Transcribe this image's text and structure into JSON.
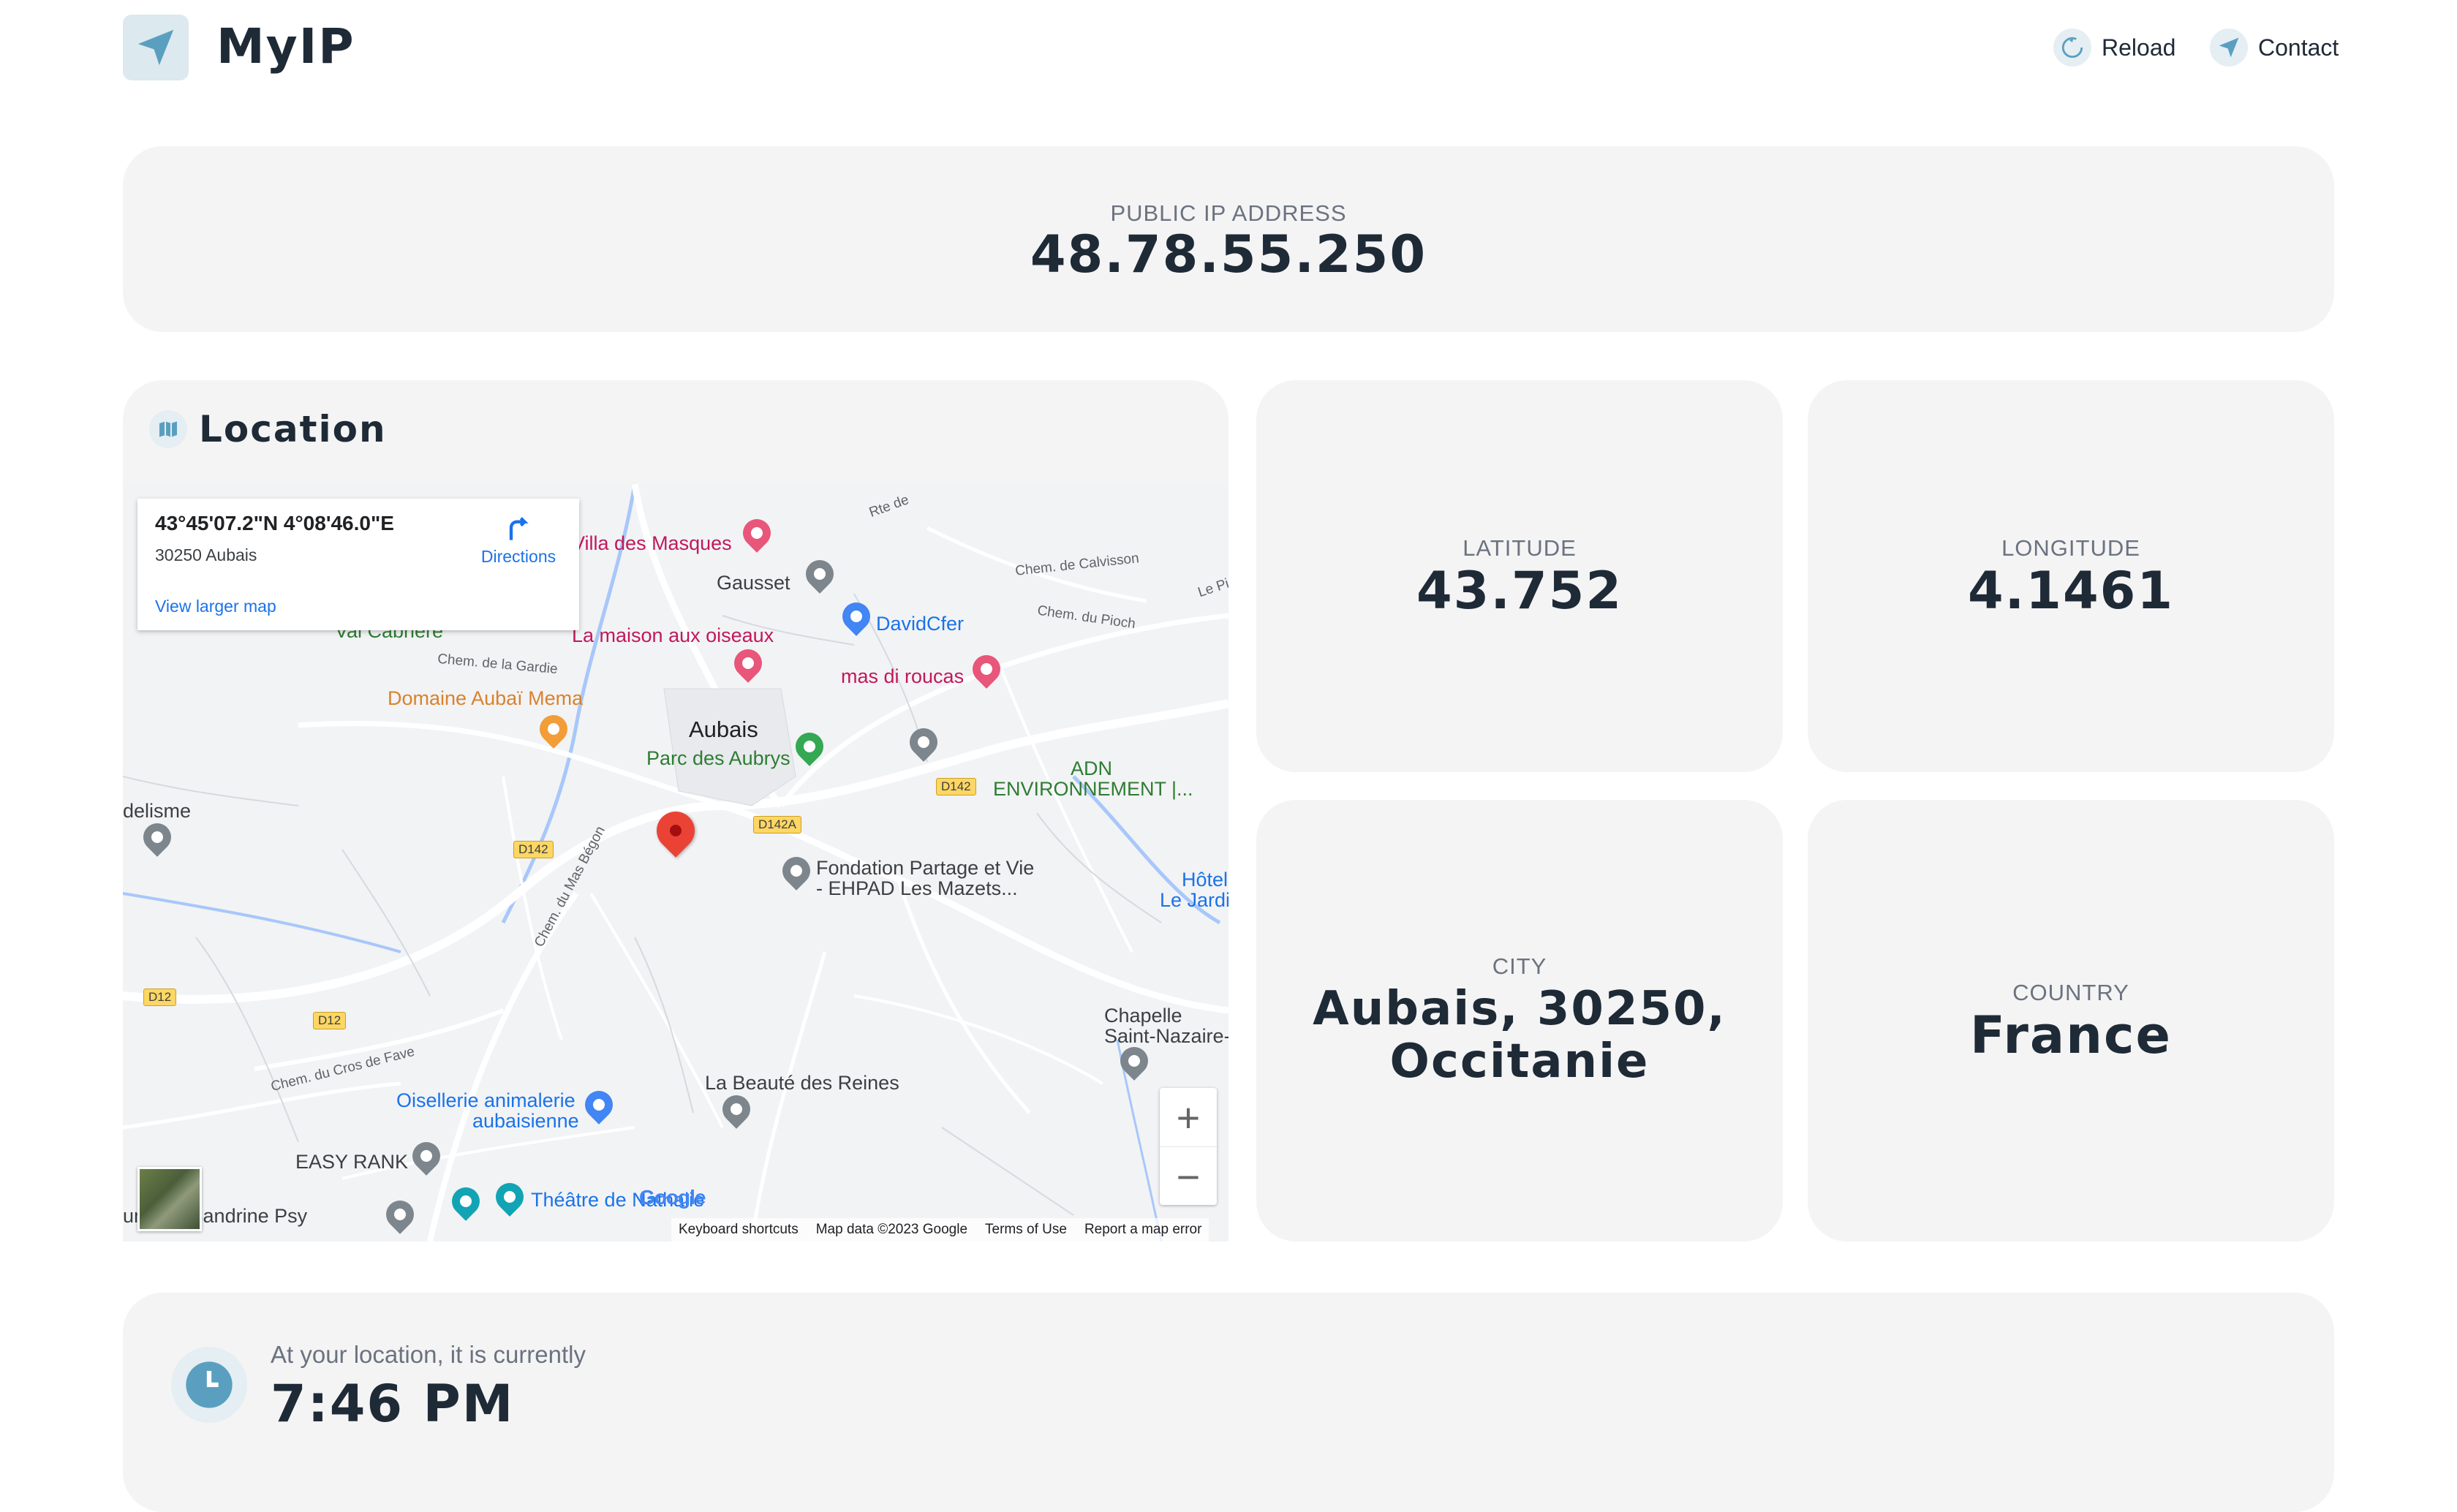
{
  "header": {
    "app_name": "MyIP",
    "nav": [
      {
        "label": "Reload",
        "icon": "reload-icon"
      },
      {
        "label": "Contact",
        "icon": "send-icon"
      }
    ]
  },
  "ip": {
    "label": "PUBLIC IP ADDRESS",
    "value": "48.78.55.250"
  },
  "location": {
    "title": "Location",
    "map": {
      "info": {
        "coords": "43°45'07.2\"N 4°08'46.0\"E",
        "address": "30250 Aubais",
        "directions": "Directions",
        "view_larger": "View larger map"
      },
      "places": [
        "Villa des Masques",
        "Gausset",
        "DavidCfer",
        "La maison aux oiseaux",
        "mas di roucas",
        "Val Cabrière",
        "Domaine Aubaï Mema",
        "Aubais",
        "Parc des Aubrys",
        "ADN",
        "ENVIRONNEMENT |...",
        "delisme",
        "Fondation Partage et Vie",
        "- EHPAD Les Mazets...",
        "Hôtel",
        "Le Jardi",
        "Chapelle",
        "Saint-Nazaire-",
        "La Beauté des Reines",
        "Oisellerie animalerie",
        "aubaisienne",
        "EASY RANK",
        "Théâtre de Nathalie",
        "umbert Sandrine Psy"
      ],
      "roads": [
        "Rte de",
        "Chem. de Calvisson",
        "Chem. du Pioch",
        "Chem. de la Gardie",
        "Chem. du Mas Bégon",
        "Chem. du Cros de Fave",
        "Le Pi"
      ],
      "shields": [
        "D142",
        "D142A",
        "D142",
        "D12",
        "D12"
      ],
      "zoom_in": "+",
      "zoom_out": "−",
      "google": "Google",
      "attribution": [
        "Keyboard shortcuts",
        "Map data ©2023 Google",
        "Terms of Use",
        "Report a map error"
      ]
    }
  },
  "latitude": {
    "label": "LATITUDE",
    "value": "43.752"
  },
  "longitude": {
    "label": "LONGITUDE",
    "value": "4.1461"
  },
  "city": {
    "label": "CITY",
    "value_line1": "Aubais, 30250,",
    "value_line2": "Occitanie"
  },
  "country": {
    "label": "COUNTRY",
    "value": "France"
  },
  "time": {
    "label": "At your location, it is currently",
    "value": "7:46 PM"
  },
  "colors": {
    "card": "#f4f4f4",
    "text": "#1f2a37",
    "accent": "#5a9fc0",
    "icon_bg": "#dce9ef"
  }
}
